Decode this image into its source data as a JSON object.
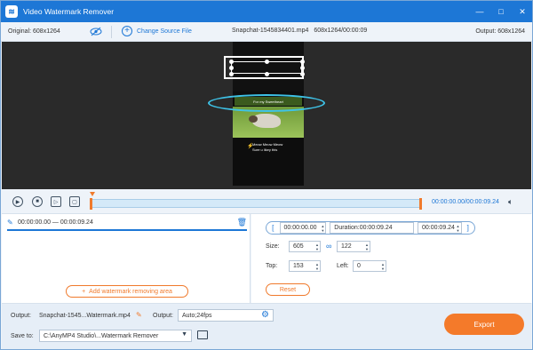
{
  "window": {
    "title": "Video Watermark Remover",
    "controls": [
      "—",
      "□",
      "✕"
    ]
  },
  "info": {
    "original": "Original: 608x1264",
    "change_source": "Change Source File",
    "file": "Snapchat-1545834401.mp4",
    "file_meta": "608x1264/00:00:09",
    "output": "Output: 608x1264"
  },
  "preview": {
    "caption": "For my Sweetheart",
    "song_title": "Meow Meow Meow",
    "song_artist": "Sure u likey this"
  },
  "playback": {
    "time": "00:00:00.00/00:00:09.24"
  },
  "segment": {
    "time": "00:00:00.00 — 00:00:09.24",
    "add_label": "Add watermark removing area"
  },
  "range": {
    "start": "00:00:00.00",
    "duration_label": "Duration:",
    "duration": "00:00:09.24",
    "end": "00:00:09.24"
  },
  "size": {
    "label": "Size:",
    "w": "605",
    "h": "122"
  },
  "pos": {
    "top_label": "Top:",
    "top": "153",
    "left_label": "Left:",
    "left": "0"
  },
  "reset_label": "Reset",
  "bottom": {
    "output_label": "Output:",
    "output_file": "Snapchat-1545...Watermark.mp4",
    "output2_label": "Output:",
    "output_format": "Auto;24fps",
    "saveto_label": "Save to:",
    "saveto_path": "C:\\AnyMP4 Studio\\...Watermark Remover",
    "export_label": "Export"
  },
  "colors": {
    "accent": "#1d77d6",
    "orange": "#f07a2c",
    "ellipse": "#3ec3e8"
  }
}
